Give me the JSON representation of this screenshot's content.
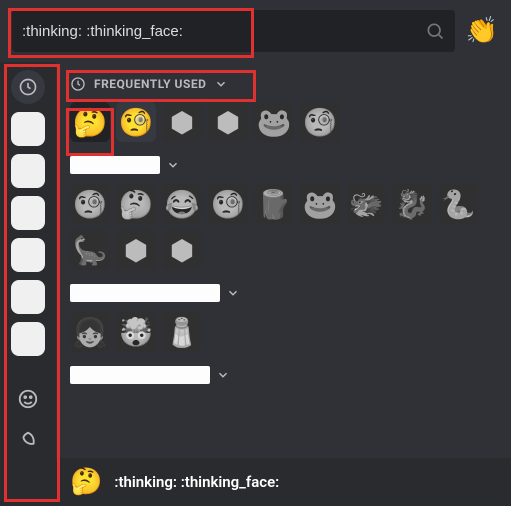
{
  "search": {
    "value": ":thinking: :thinking_face:",
    "placeholder": "Search"
  },
  "skinToneEmoji": "👏",
  "section": {
    "title": "FREQUENTLY USED"
  },
  "grid1": [
    {
      "g": "🤔",
      "name": "thinking",
      "sel": true,
      "gray": false
    },
    {
      "g": "🧐",
      "name": "monocle",
      "sel": false,
      "gray": false
    },
    {
      "g": "⬢",
      "name": "d20-a",
      "sel": false,
      "gray": true
    },
    {
      "g": "⬢",
      "name": "d20-b",
      "sel": false,
      "gray": true
    },
    {
      "g": "🐸",
      "name": "frog",
      "sel": false,
      "gray": true
    },
    {
      "g": "🧐",
      "name": "monocle-gray",
      "sel": false,
      "gray": true
    }
  ],
  "grid2": [
    {
      "g": "🧐",
      "name": "monocle2",
      "gray": true
    },
    {
      "g": "🤔",
      "name": "thinking2",
      "gray": true
    },
    {
      "g": "😂",
      "name": "joy",
      "gray": true
    },
    {
      "g": "🧐",
      "name": "monocle3",
      "gray": true
    },
    {
      "g": "🪵",
      "name": "log",
      "gray": true
    },
    {
      "g": "🐸",
      "name": "frog2",
      "gray": true
    },
    {
      "g": "🐲",
      "name": "dragon-text",
      "gray": true
    },
    {
      "g": "🐉",
      "name": "dragon",
      "gray": true
    },
    {
      "g": "🐍",
      "name": "snake",
      "gray": true
    },
    {
      "g": "🦕",
      "name": "sauropod",
      "gray": true
    },
    {
      "g": "⬢",
      "name": "d20-c",
      "gray": true
    },
    {
      "g": "⬢",
      "name": "d20-d",
      "gray": true
    }
  ],
  "grid3": [
    {
      "g": "👧",
      "name": "avatar",
      "gray": true
    },
    {
      "g": "🤯",
      "name": "mindblown",
      "gray": true
    },
    {
      "g": "🧂",
      "name": "salt",
      "gray": true
    }
  ],
  "preview": {
    "emoji": "🤔",
    "text": ":thinking: :thinking_face:"
  }
}
